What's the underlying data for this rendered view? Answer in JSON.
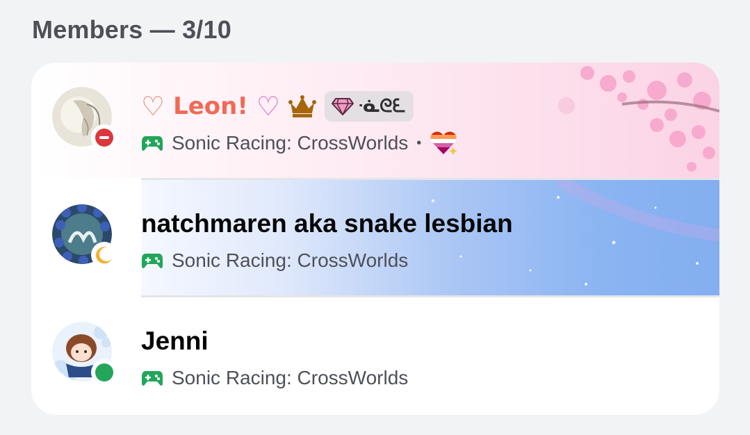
{
  "header": {
    "title": "Members — 3/10"
  },
  "members": [
    {
      "name_prefix": "♡",
      "name": "Leon!",
      "name_suffix": "♡",
      "status": "do-not-disturb",
      "badge_icon": "crown-icon",
      "tag_icon": "gem-icon",
      "tag_text": "ᓍᘓᘍ",
      "activity_icon": "gamepad-icon",
      "activity": "Sonic Racing: CrossWorlds",
      "extra_icon": "lesbian-flag-heart-icon"
    },
    {
      "name": "natchmaren aka snake lesbian",
      "status": "idle",
      "activity_icon": "gamepad-icon",
      "activity": "Sonic Racing: CrossWorlds"
    },
    {
      "name": "Jenni",
      "status": "online",
      "activity_icon": "gamepad-icon",
      "activity": "Sonic Racing: CrossWorlds"
    }
  ],
  "colors": {
    "online": "#23a55a",
    "dnd": "#da373c",
    "idle": "#f0b232",
    "gamepad": "#23a55a",
    "crown": "#a5670a"
  }
}
